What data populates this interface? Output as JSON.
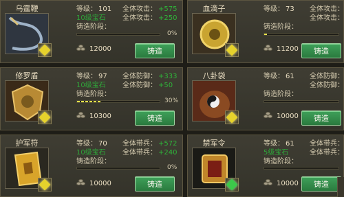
{
  "labels": {
    "level": "等级：",
    "stage": "铸造阶段：",
    "forge": "铸造"
  },
  "items": [
    {
      "name": "乌霆鞭",
      "level": "101",
      "stat_label": "全体攻击：",
      "stat_val": "+575",
      "stat2_label": "全体攻击：",
      "stat2_val": "+250",
      "green_line": "10级宝石",
      "progress_pct": "0%",
      "progress": 0,
      "cost": "12000",
      "gem": "yellow"
    },
    {
      "name": "血滴子",
      "level": "73",
      "stat_label": "全体攻击：",
      "stat_val": "",
      "stat2_label": "全体攻击：",
      "stat2_val": "",
      "green_line": "",
      "progress_pct": "",
      "progress": 0.05,
      "cost": "11200",
      "gem": "yellow"
    },
    {
      "name": "修罗盾",
      "level": "97",
      "stat_label": "全体防御：",
      "stat_val": "+333",
      "stat2_label": "全体防御：",
      "stat2_val": "+50",
      "green_line": "10级宝石",
      "progress_pct": "30%",
      "progress": 0.3,
      "cost": "10300",
      "gem": "yellow"
    },
    {
      "name": "八卦袋",
      "level": "61",
      "stat_label": "全体防御：",
      "stat_val": "",
      "stat2_label": "全体防御：",
      "stat2_val": "",
      "green_line": "",
      "progress_pct": "",
      "progress": 0,
      "cost": "10000",
      "gem": "yellow"
    },
    {
      "name": "护军符",
      "level": "70",
      "stat_label": "全体带兵：",
      "stat_val": "+572",
      "stat2_label": "全体带兵：",
      "stat2_val": "+240",
      "green_line": "10级宝石",
      "progress_pct": "0%",
      "progress": 0,
      "cost": "10000",
      "gem": "yellow"
    },
    {
      "name": "禁军令",
      "level": "61",
      "stat_label": "全体带兵：",
      "stat_val": "",
      "stat2_label": "全体带兵：",
      "stat2_val": "",
      "green_line": "5级宝石",
      "progress_pct": "",
      "progress": 0,
      "cost": "10000",
      "gem": "green"
    }
  ]
}
